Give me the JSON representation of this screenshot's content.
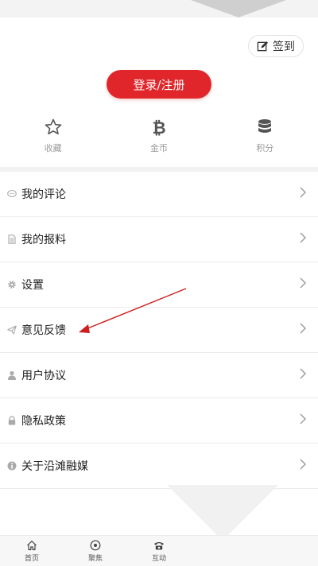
{
  "header": {
    "checkin_label": "签到"
  },
  "login": {
    "button_label": "登录/注册"
  },
  "stats": [
    {
      "label": "收藏",
      "icon": "star-icon"
    },
    {
      "label": "金币",
      "icon": "bitcoin-icon"
    },
    {
      "label": "积分",
      "icon": "database-icon"
    }
  ],
  "menu": {
    "items": [
      {
        "label": "我的评论",
        "icon": "comment-icon"
      },
      {
        "label": "我的报料",
        "icon": "document-icon"
      },
      {
        "label": "设置",
        "icon": "gear-icon"
      },
      {
        "label": "意见反馈",
        "icon": "paper-plane-icon"
      },
      {
        "label": "用户协议",
        "icon": "user-icon"
      },
      {
        "label": "隐私政策",
        "icon": "lock-icon"
      },
      {
        "label": "关于沿滩融媒",
        "icon": "info-icon"
      }
    ]
  },
  "tabbar": {
    "items": [
      {
        "label": "首页",
        "icon": "home-icon"
      },
      {
        "label": "聚焦",
        "icon": "focus-icon"
      },
      {
        "label": "互动",
        "icon": "phone-icon"
      }
    ]
  },
  "colors": {
    "accent": "#e0262a",
    "annotation_arrow": "#cc1f1f"
  }
}
